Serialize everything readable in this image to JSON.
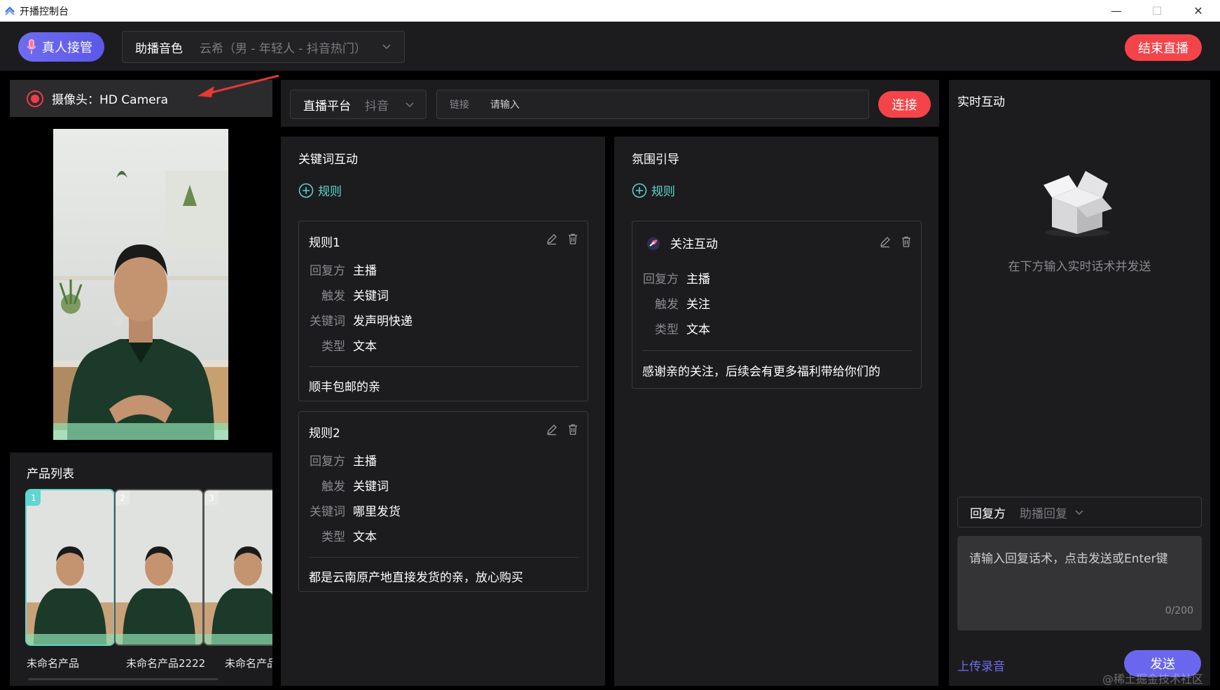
{
  "window": {
    "title": "开播控制台",
    "minimize": "—",
    "maximize": "☐",
    "close": "✕"
  },
  "toolbar": {
    "takeover_label": "真人接管",
    "voice_label": "助播音色",
    "voice_value": "云希（男 - 年轻人 - 抖音热门）",
    "end_live_label": "结束直播"
  },
  "camera": {
    "label": "摄像头：HD Camera"
  },
  "products": {
    "title": "产品列表",
    "items": [
      {
        "index": "1",
        "name": "未命名产品"
      },
      {
        "index": "2",
        "name": "未命名产品2222"
      },
      {
        "index": "3",
        "name": "未命名产品"
      }
    ]
  },
  "platform": {
    "label": "直播平台",
    "value": "抖音",
    "link_label": "链接",
    "link_placeholder": "请输入",
    "connect_label": "连接"
  },
  "keyword_panel": {
    "title": "关键词互动",
    "add_rule": "规则",
    "rules": [
      {
        "title": "规则1",
        "replier_k": "回复方",
        "replier_v": "主播",
        "trigger_k": "触发",
        "trigger_v": "关键词",
        "keyword_k": "关键词",
        "keyword_v": "发声明快递",
        "type_k": "类型",
        "type_v": "文本",
        "reply": "顺丰包邮的亲"
      },
      {
        "title": "规则2",
        "replier_k": "回复方",
        "replier_v": "主播",
        "trigger_k": "触发",
        "trigger_v": "关键词",
        "keyword_k": "关键词",
        "keyword_v": "哪里发货",
        "type_k": "类型",
        "type_v": "文本",
        "reply": "都是云南原产地直接发货的亲，放心购买"
      }
    ]
  },
  "atmosphere_panel": {
    "title": "氛围引导",
    "add_rule": "规则",
    "rule": {
      "title": "关注互动",
      "replier_k": "回复方",
      "replier_v": "主播",
      "trigger_k": "触发",
      "trigger_v": "关注",
      "type_k": "类型",
      "type_v": "文本",
      "reply": "感谢亲的关注，后续会有更多福利带给你们的"
    }
  },
  "realtime": {
    "title": "实时互动",
    "empty_text": "在下方输入实时话术并发送",
    "replier_label": "回复方",
    "replier_value": "助播回复",
    "input_placeholder": "请输入回复话术，点击发送或Enter键",
    "counter": "0/200",
    "upload_label": "上传录音",
    "send_label": "发送"
  },
  "watermark": "@稀土掘金技术社区",
  "colors": {
    "accent": "#6a67ee",
    "danger": "#f4444a",
    "teal": "#5fd6cf",
    "bg": "#000000",
    "panel": "#1c1c1e"
  }
}
